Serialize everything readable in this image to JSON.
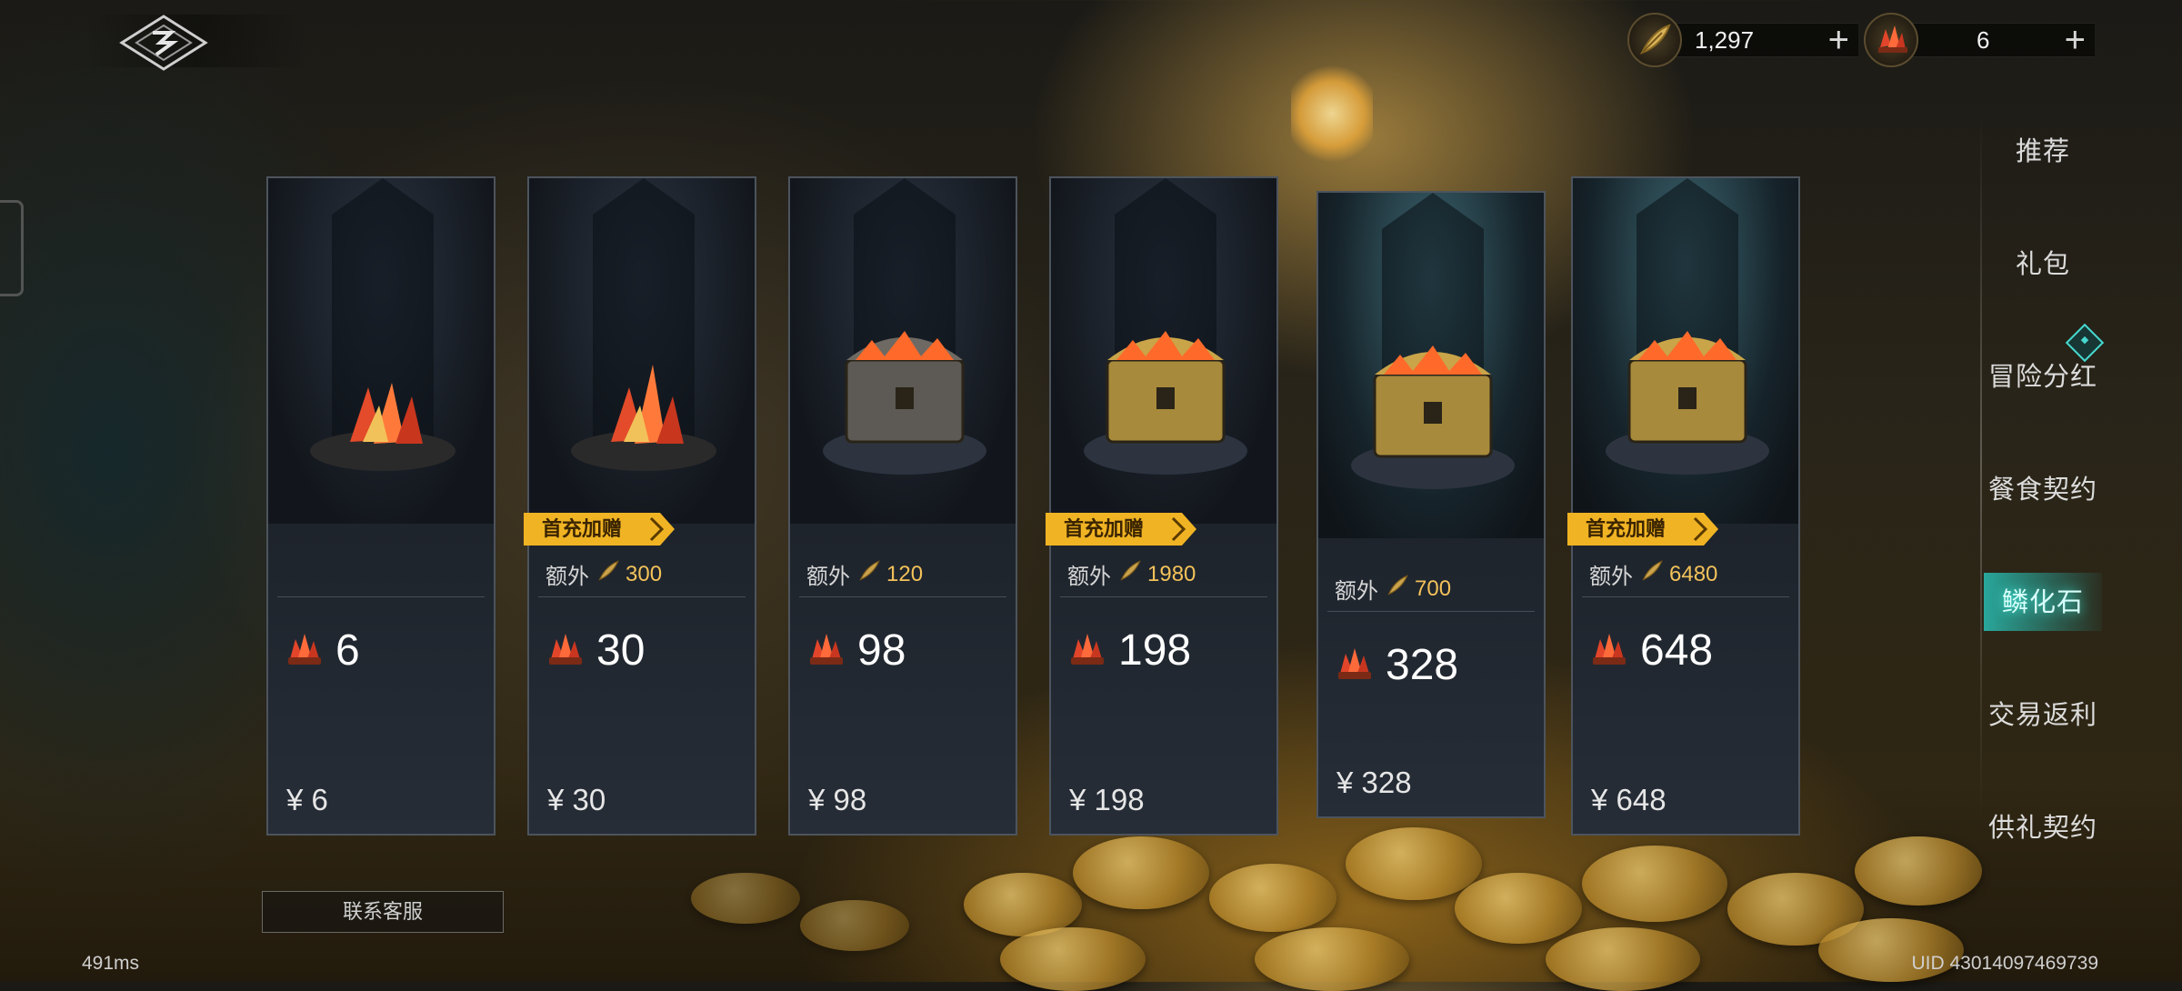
{
  "currency": {
    "gold": {
      "icon": "gold-feather-icon",
      "value": "1,297",
      "plus": "+"
    },
    "crystal": {
      "icon": "red-crystal-icon",
      "value": "6",
      "plus": "+"
    }
  },
  "nav": {
    "items": [
      {
        "label": "推荐"
      },
      {
        "label": "礼包"
      },
      {
        "label": "冒险分红"
      },
      {
        "label": "餐食契约"
      },
      {
        "label": "鳞化石"
      },
      {
        "label": "交易返利"
      },
      {
        "label": "供礼契约"
      }
    ],
    "active_index": 4
  },
  "cards": [
    {
      "amount": "6",
      "price": "¥ 6",
      "extra_label": "",
      "extra_value": "",
      "badge": ""
    },
    {
      "amount": "30",
      "price": "¥ 30",
      "extra_label": "额外",
      "extra_value": "300",
      "badge": "首充加赠"
    },
    {
      "amount": "98",
      "price": "¥ 98",
      "extra_label": "额外",
      "extra_value": "120",
      "badge": ""
    },
    {
      "amount": "198",
      "price": "¥ 198",
      "extra_label": "额外",
      "extra_value": "1980",
      "badge": "首充加赠"
    },
    {
      "amount": "328",
      "price": "¥ 328",
      "extra_label": "额外",
      "extra_value": "700",
      "badge": ""
    },
    {
      "amount": "648",
      "price": "¥ 648",
      "extra_label": "额外",
      "extra_value": "6480",
      "badge": "首充加赠"
    }
  ],
  "footer": {
    "support_label": "联系客服",
    "latency": "491ms",
    "uid": "UID 43014097469739"
  },
  "colors": {
    "accent_teal": "#3ff0e0",
    "badge_gold": "#f0b323",
    "extra_value": "#f3c25a"
  }
}
